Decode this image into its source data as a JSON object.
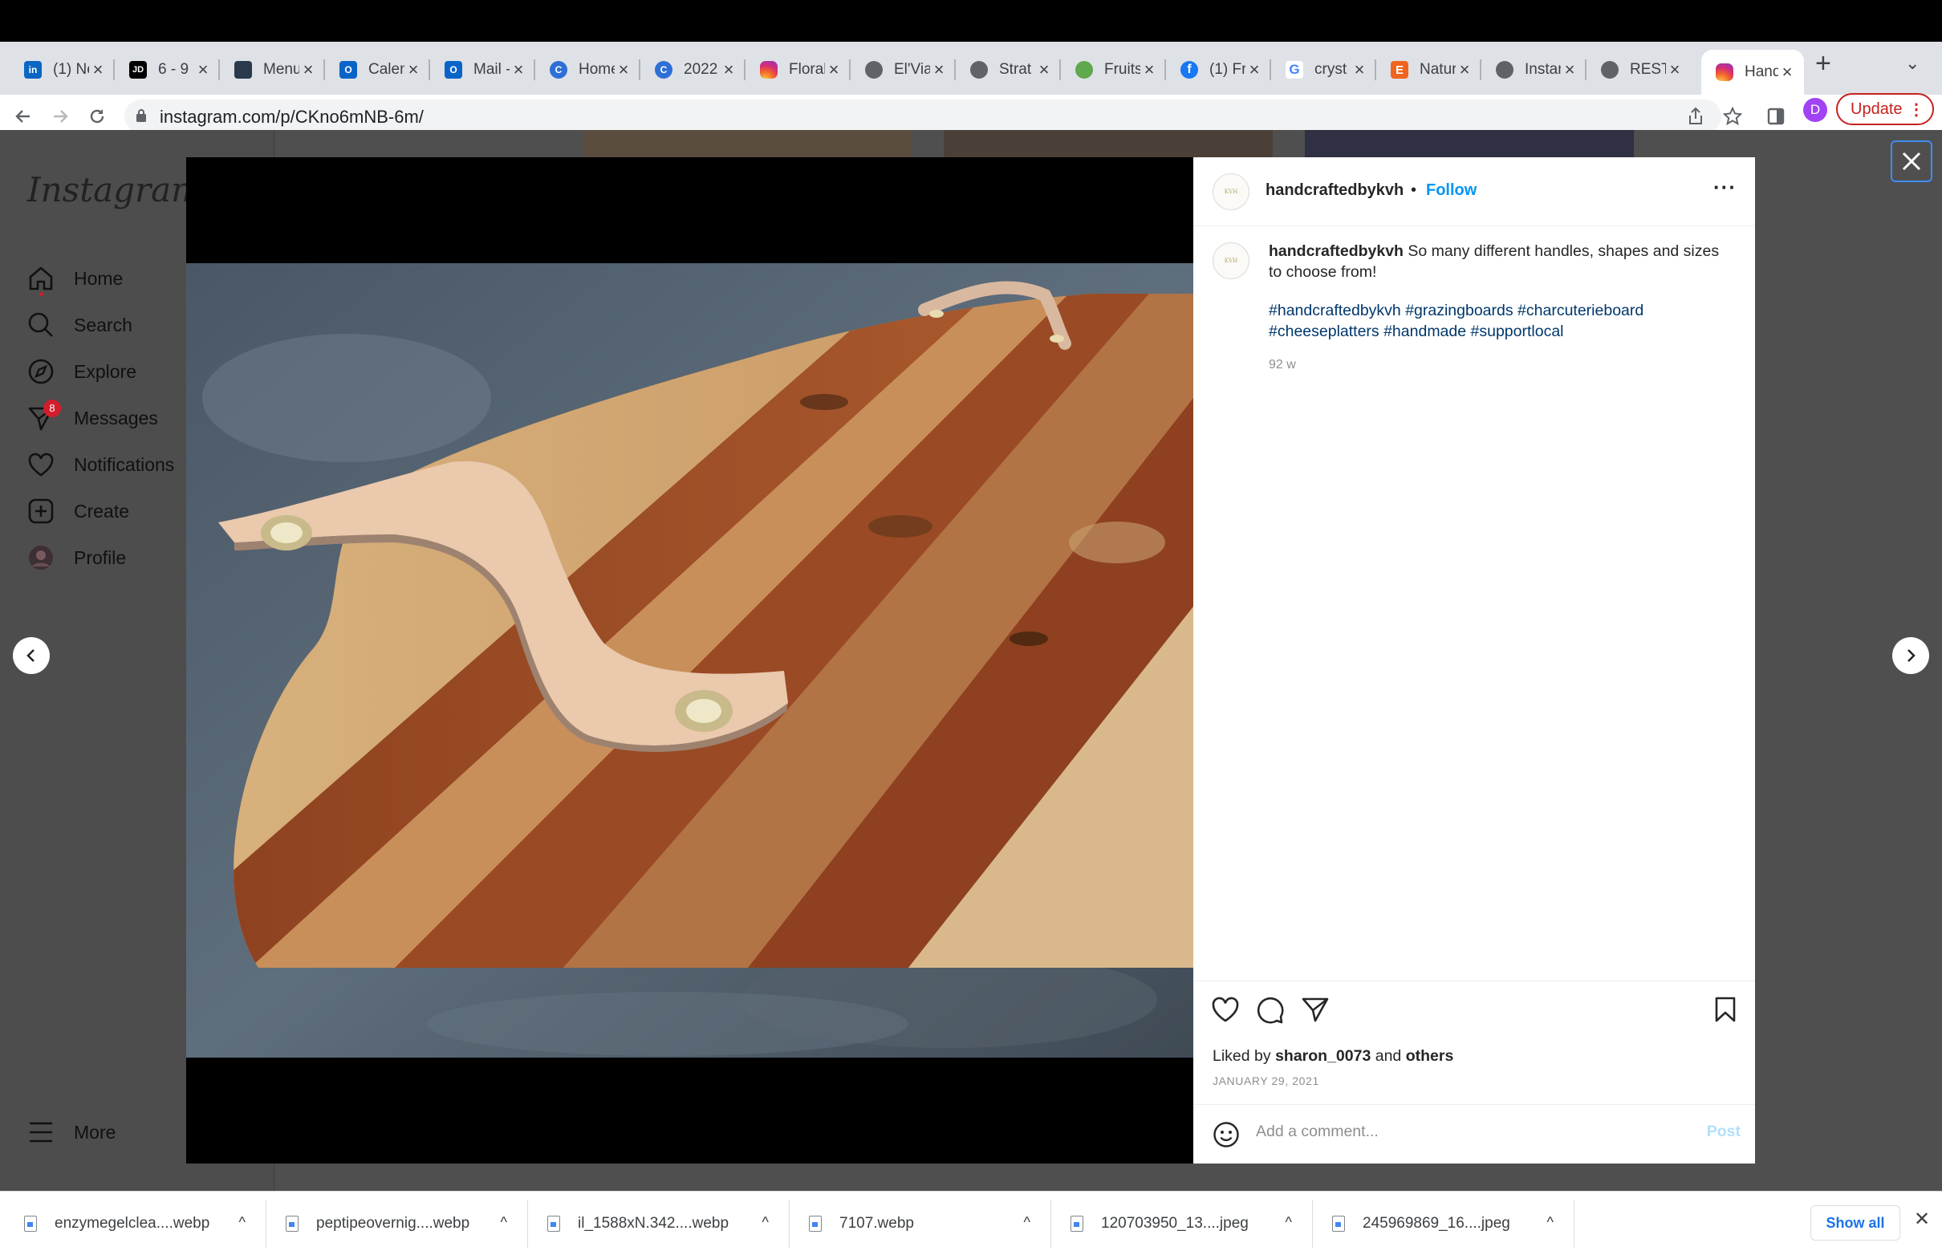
{
  "browser": {
    "tabs": [
      {
        "label": "(1) Ne",
        "icon": "linkedin-icon",
        "color": "#0a66c2",
        "glyph": "in"
      },
      {
        "label": "6 - 9",
        "icon": "jd-icon",
        "color": "#000000",
        "glyph": "JD"
      },
      {
        "label": "Menu",
        "icon": "menu-site-icon",
        "color": "#2b3a4a",
        "glyph": ""
      },
      {
        "label": "Calen",
        "icon": "outlook-calendar-icon",
        "color": "#0a64c8",
        "glyph": "O"
      },
      {
        "label": "Mail -",
        "icon": "outlook-mail-icon",
        "color": "#0a64c8",
        "glyph": "O"
      },
      {
        "label": "Home",
        "icon": "c-logo-icon",
        "color": "#2d6fd6",
        "glyph": "C"
      },
      {
        "label": "2022",
        "icon": "c-logo-icon",
        "color": "#2d6fd6",
        "glyph": "C"
      },
      {
        "label": "Floral",
        "icon": "instagram-icon",
        "color": "#e1306c",
        "glyph": ""
      },
      {
        "label": "El'Via",
        "icon": "globe-icon",
        "color": "#5f6368",
        "glyph": ""
      },
      {
        "label": "Strat",
        "icon": "globe-icon",
        "color": "#5f6368",
        "glyph": ""
      },
      {
        "label": "Fruits",
        "icon": "fruits-site-icon",
        "color": "#5fa84b",
        "glyph": ""
      },
      {
        "label": "(1) Fr",
        "icon": "facebook-icon",
        "color": "#1877f2",
        "glyph": "f"
      },
      {
        "label": "cryst",
        "icon": "google-icon",
        "color": "#ffffff",
        "glyph": "G"
      },
      {
        "label": "Natur",
        "icon": "etsy-icon",
        "color": "#f1641e",
        "glyph": "E"
      },
      {
        "label": "Instan",
        "icon": "globe-icon",
        "color": "#5f6368",
        "glyph": ""
      },
      {
        "label": "REST",
        "icon": "globe-icon",
        "color": "#5f6368",
        "glyph": ""
      },
      {
        "label": "Hand",
        "icon": "instagram-icon",
        "color": "#e1306c",
        "glyph": "",
        "active": true
      }
    ],
    "new_tab_glyph": "+",
    "url": "instagram.com/p/CKno6mNB-6m/",
    "profile_initial": "D",
    "update_label": "Update"
  },
  "instagram": {
    "logo": "Instagram",
    "nav": [
      {
        "label": "Home",
        "icon": "home-icon"
      },
      {
        "label": "Search",
        "icon": "search-icon"
      },
      {
        "label": "Explore",
        "icon": "compass-icon"
      },
      {
        "label": "Messages",
        "icon": "messenger-icon",
        "badge": "8"
      },
      {
        "label": "Notifications",
        "icon": "heart-icon"
      },
      {
        "label": "Create",
        "icon": "create-icon"
      },
      {
        "label": "Profile",
        "icon": "profile-avatar-icon"
      }
    ],
    "more_label": "More",
    "post": {
      "username": "handcraftedbykvh",
      "separator": "•",
      "follow_label": "Follow",
      "caption": "So many different handles, shapes and sizes to choose from!",
      "hashtags": "#handcraftedbykvh #grazingboards #charcuterieboard #cheeseplatters #handmade #supportlocal",
      "time_ago": "92 w",
      "liked_prefix": "Liked by",
      "liked_user": "sharon_0073",
      "liked_and": "and",
      "liked_others": "others",
      "date": "JANUARY 29, 2021",
      "comment_placeholder": "Add a comment...",
      "post_label": "Post"
    }
  },
  "downloads": {
    "items": [
      "enzymegelclea....webp",
      "peptipeovernig....webp",
      "il_1588xN.342....webp",
      "7107.webp",
      "120703950_13....jpeg",
      "245969869_16....jpeg"
    ],
    "show_all_label": "Show all"
  }
}
